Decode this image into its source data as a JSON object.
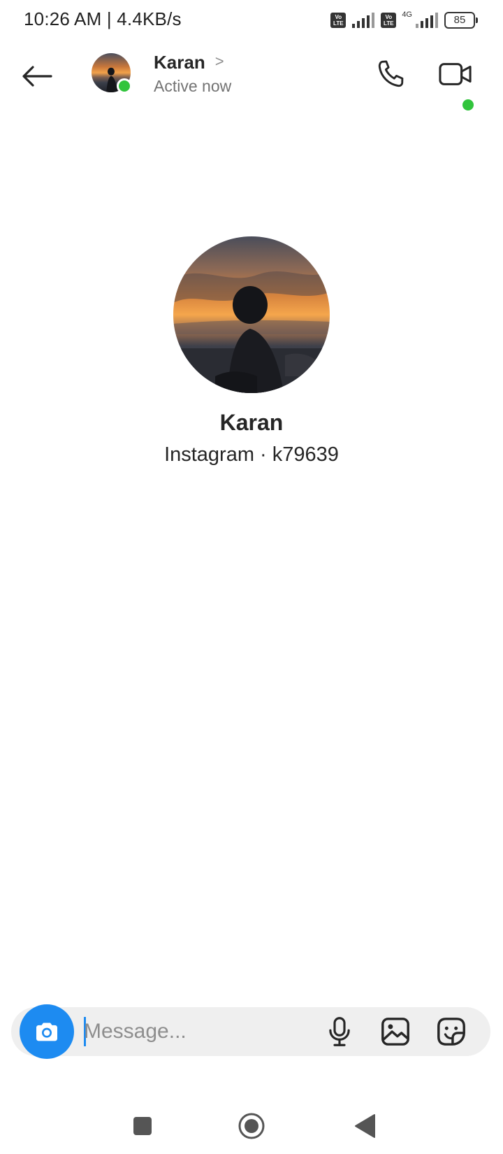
{
  "status_bar": {
    "time_speed": "10:26 AM | 4.4KB/s",
    "volte_label": "Vo LTE",
    "network_type": "4G",
    "battery": "85"
  },
  "header": {
    "name": "Karan",
    "status": "Active now",
    "chevron": ">"
  },
  "profile": {
    "name": "Karan",
    "subtitle": "Instagram · k79639"
  },
  "composer": {
    "placeholder": "Message..."
  },
  "colors": {
    "accent": "#1d8bf1",
    "online": "#31c43c"
  },
  "icons": [
    "back-arrow-icon",
    "phone-icon",
    "video-camera-icon",
    "camera-icon",
    "microphone-icon",
    "image-icon",
    "sticker-icon",
    "square-icon",
    "circle-icon",
    "triangle-icon"
  ]
}
